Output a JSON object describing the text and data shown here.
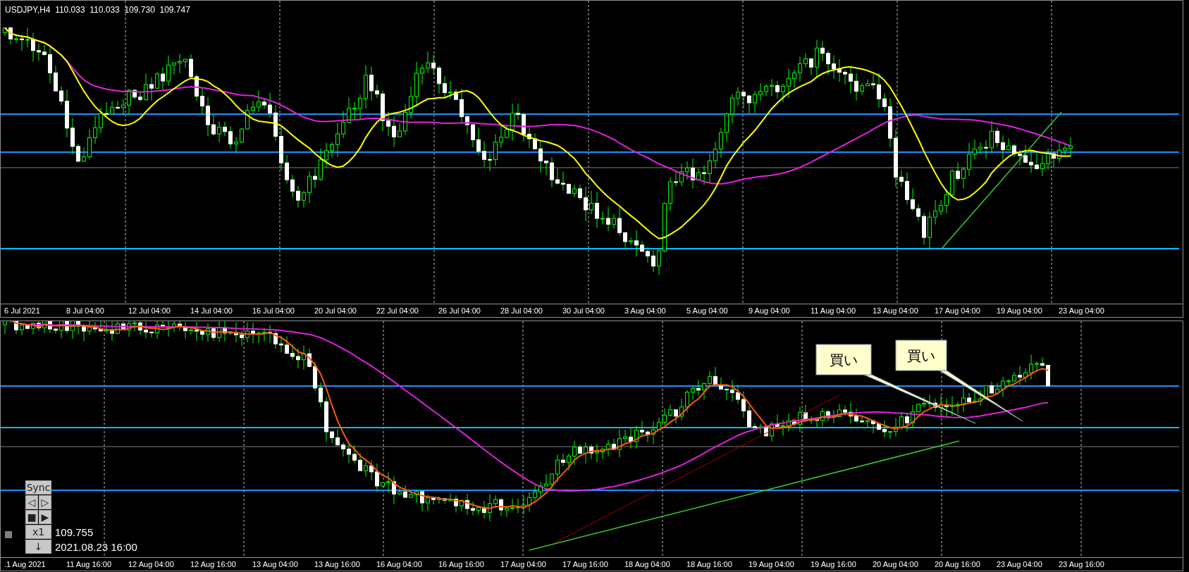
{
  "top_chart": {
    "symbol": "USDJPY,H4",
    "ohlc": [
      "110.033",
      "110.033",
      "109.730",
      "109.747"
    ],
    "x_labels": [
      "6 Jul 2021",
      "8 Jul 04:00",
      "12 Jul 04:00",
      "14 Jul 04:00",
      "16 Jul 04:00",
      "20 Jul 04:00",
      "22 Jul 04:00",
      "26 Jul 04:00",
      "28 Jul 04:00",
      "30 Jul 04:00",
      "3 Aug 04:00",
      "5 Aug 04:00",
      "9 Aug 04:00",
      "11 Aug 04:00",
      "13 Aug 04:00",
      "17 Aug 04:00",
      "19 Aug 04:00",
      "23 Aug 04:00"
    ]
  },
  "bottom_chart": {
    "x_labels": [
      ".1 Aug 2021",
      "11 Aug 16:00",
      "12 Aug 04:00",
      "12 Aug 16:00",
      "13 Aug 04:00",
      "13 Aug 16:00",
      "16 Aug 04:00",
      "16 Aug 16:00",
      "17 Aug 04:00",
      "17 Aug 16:00",
      "18 Aug 04:00",
      "18 Aug 16:00",
      "19 Aug 04:00",
      "19 Aug 16:00",
      "20 Aug 04:00",
      "20 Aug 16:00",
      "23 Aug 04:00",
      "23 Aug 16:00"
    ],
    "callouts": [
      {
        "text": "買い"
      },
      {
        "text": "買い"
      }
    ],
    "sync_panel": {
      "title": "Sync",
      "prev": "◁",
      "next": "▷",
      "stop": "■",
      "play": "▶",
      "speed": "x1",
      "down": "↓",
      "price": "109.755",
      "datetime": "2021.08.23 16:00"
    }
  }
}
